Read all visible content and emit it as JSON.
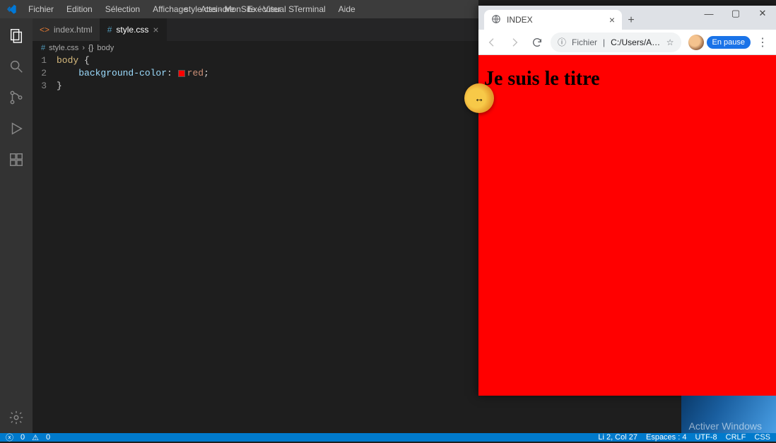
{
  "vscode": {
    "menu": [
      "Fichier",
      "Edition",
      "Sélection",
      "Affichage",
      "Atteindre",
      "Exécuter",
      "Terminal",
      "Aide"
    ],
    "window_title": "style.css - MonSite - Visual S",
    "tabs": [
      {
        "label": "index.html",
        "active": false
      },
      {
        "label": "style.css",
        "active": true
      }
    ],
    "breadcrumb": {
      "file": "style.css",
      "symbol": "body"
    },
    "code": {
      "l1": {
        "num": "1",
        "selector": "body",
        "brace": "{"
      },
      "l2": {
        "num": "2",
        "indent": "    ",
        "prop": "background-color",
        "colon": ": ",
        "val": "red",
        "semi": ";"
      },
      "l3": {
        "num": "3",
        "brace": "}"
      }
    },
    "status": {
      "problems": "0",
      "warnings": "0",
      "line_col": "Li 2, Col 27",
      "spaces": "Espaces : 4",
      "encoding": "UTF-8",
      "eol": "CRLF",
      "lang": "CSS"
    }
  },
  "chrome": {
    "tab_title": "INDEX",
    "address": {
      "scheme_label": "Fichier",
      "path": "C:/Users/Adminis..."
    },
    "profile_label": "En pause",
    "page_heading": "Je suis le titre"
  },
  "watermark": "Activer Windows",
  "resize_cursor_glyph": "↔"
}
